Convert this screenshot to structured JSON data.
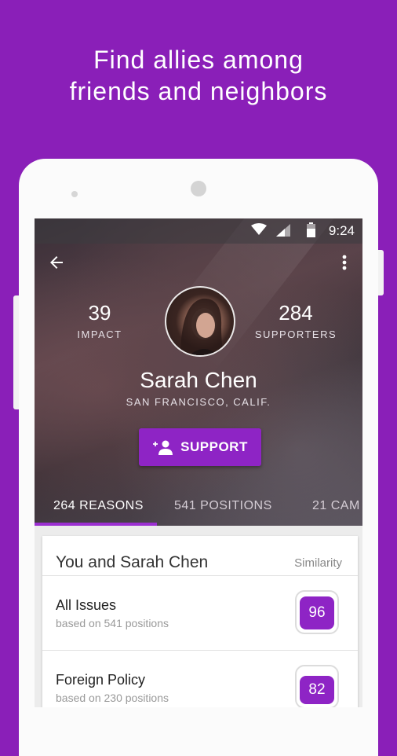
{
  "headline": {
    "line1": "Find allies among",
    "line2": "friends and neighbors"
  },
  "statusbar": {
    "time": "9:24",
    "icons": [
      "wifi-icon",
      "signal-icon",
      "battery-icon"
    ]
  },
  "toolbar": {
    "back_icon": "arrow-back-icon",
    "menu_icon": "more-vert-icon"
  },
  "profile": {
    "impact_value": "39",
    "impact_label": "IMPACT",
    "supporters_value": "284",
    "supporters_label": "SUPPORTERS",
    "name": "Sarah Chen",
    "location": "SAN FRANCISCO, CALIF.",
    "support_label": "SUPPORT",
    "support_icon": "add-person-icon"
  },
  "tabs": [
    {
      "label": "264 REASONS",
      "active": true
    },
    {
      "label": "541 POSITIONS",
      "active": false
    },
    {
      "label": "21 CAM",
      "active": false
    }
  ],
  "card": {
    "title": "You and Sarah Chen",
    "similarity_label": "Similarity",
    "rows": [
      {
        "issue": "All Issues",
        "basis": "based on 541 positions",
        "score": "96",
        "fill_fraction": 0.96
      },
      {
        "issue": "Foreign Policy",
        "basis": "based on 230 positions",
        "score": "82",
        "fill_fraction": 0.82
      }
    ]
  },
  "colors": {
    "brand_purple": "#8a1fb8",
    "accent_purple": "#8e24c5"
  }
}
